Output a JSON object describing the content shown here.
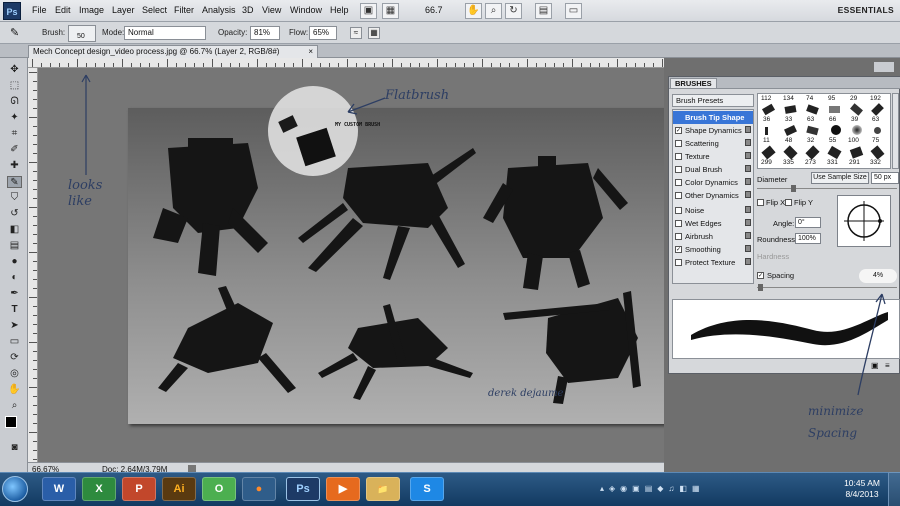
{
  "menubar": {
    "logo": "Ps",
    "items": [
      "File",
      "Edit",
      "Image",
      "Layer",
      "Select",
      "Filter",
      "Analysis",
      "3D",
      "View",
      "Window",
      "Help"
    ],
    "zoom": "66.7",
    "workspace": "ESSENTIALS"
  },
  "options": {
    "brush_label": "Brush:",
    "brush_size": "50",
    "mode_label": "Mode:",
    "mode_value": "Normal",
    "opacity_label": "Opacity:",
    "opacity_value": "81%",
    "flow_label": "Flow:",
    "flow_value": "65%"
  },
  "document": {
    "tab_title": "Mech Concept design_video process.jpg @ 66.7% (Layer 2, RGB/8#)"
  },
  "status": {
    "zoom": "66.67%",
    "doc": "Doc: 2.64M/3.79M"
  },
  "annotations": {
    "flatbrush": "Flatbrush",
    "looks_like": "looks like",
    "my_custom_brush": "MY CUSTOM BRUSH",
    "minimize_spacing": "minimize Spacing",
    "signature": "derek dejaume"
  },
  "brushes": {
    "tab": "BRUSHES",
    "presets_btn": "Brush Presets",
    "items": [
      {
        "label": "Brush Tip Shape",
        "checked": null,
        "selected": true
      },
      {
        "label": "Shape Dynamics",
        "checked": true
      },
      {
        "label": "Scattering",
        "checked": false
      },
      {
        "label": "Texture",
        "checked": false
      },
      {
        "label": "Dual Brush",
        "checked": false
      },
      {
        "label": "Color Dynamics",
        "checked": false
      },
      {
        "label": "Other Dynamics",
        "checked": false
      },
      {
        "label": "Noise",
        "checked": false
      },
      {
        "label": "Wet Edges",
        "checked": false
      },
      {
        "label": "Airbrush",
        "checked": false
      },
      {
        "label": "Smoothing",
        "checked": true
      },
      {
        "label": "Protect Texture",
        "checked": false
      }
    ],
    "presets_top": [
      "112",
      "134",
      "74",
      "95",
      "29",
      "192"
    ],
    "presets_row1": [
      "36",
      "33",
      "63",
      "66",
      "39",
      "63"
    ],
    "presets_row2": [
      "11",
      "48",
      "32",
      "55",
      "100",
      "75"
    ],
    "presets_row3": [
      "299",
      "335",
      "273",
      "331",
      "291",
      "332"
    ],
    "diameter_label": "Diameter",
    "sample_btn": "Use Sample Size",
    "diameter_value": "50 px",
    "flipx": "Flip X",
    "flipy": "Flip Y",
    "angle_label": "Angle:",
    "angle_value": "0°",
    "roundness_label": "Roundness:",
    "roundness_value": "100%",
    "hardness_label": "Hardness",
    "spacing_label": "Spacing",
    "spacing_value": "4%"
  },
  "taskbar": {
    "time": "10:45 AM",
    "date": "8/4/2013",
    "apps": [
      "W",
      "X",
      "P",
      "Ai",
      "O",
      "●",
      "Ps",
      "▶",
      "📁",
      "S"
    ]
  }
}
